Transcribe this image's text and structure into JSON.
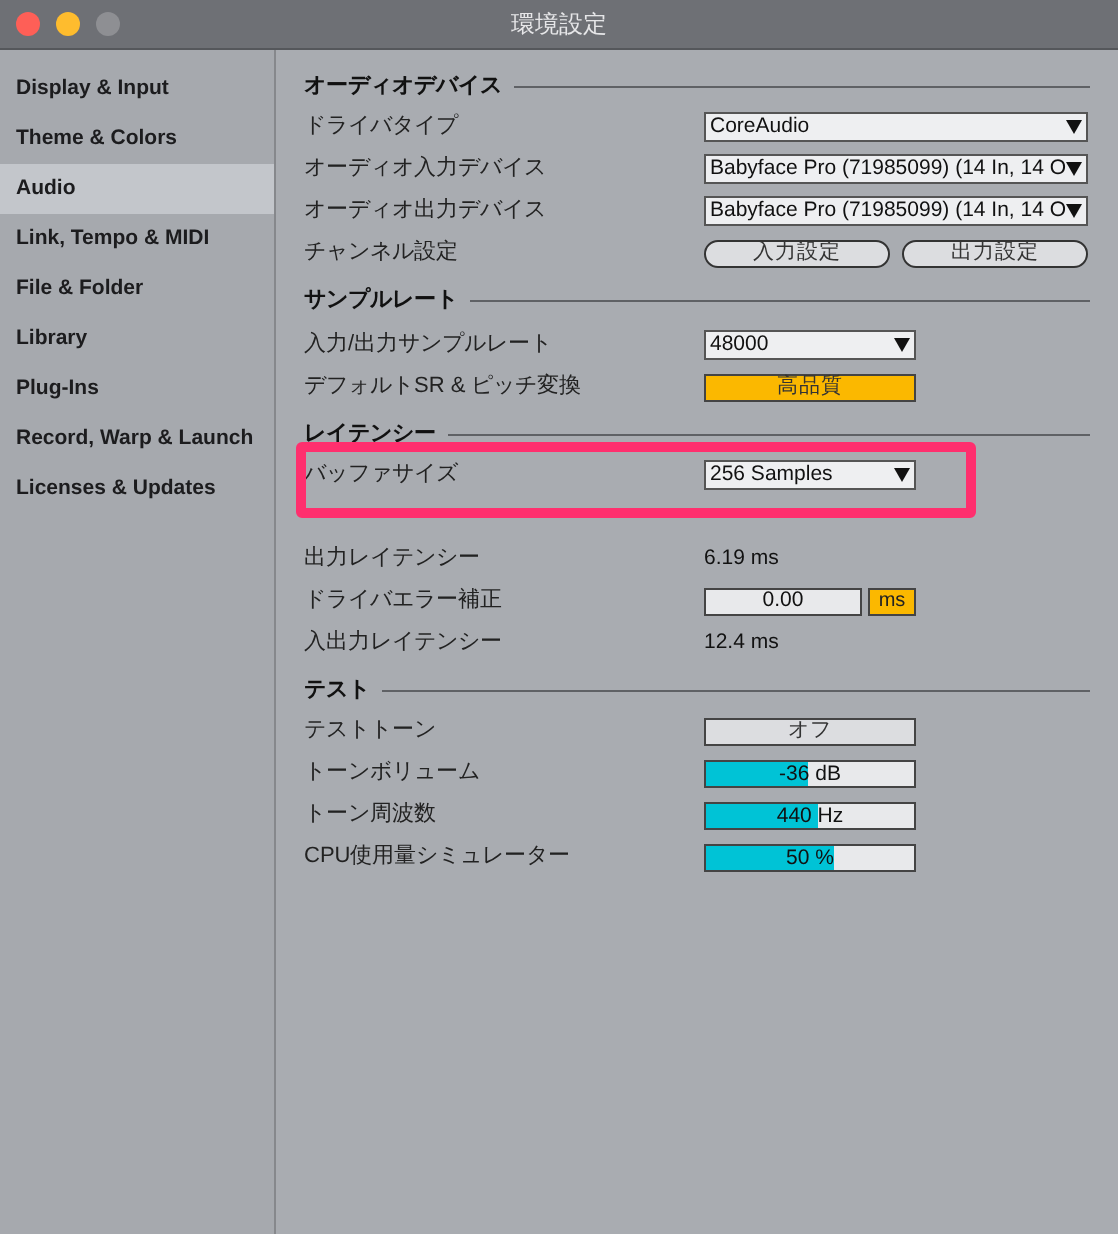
{
  "window": {
    "title": "環境設定",
    "controls": [
      {
        "color": "#fe5f57"
      },
      {
        "color": "#febc2e"
      },
      {
        "color": "#8e8f93"
      }
    ]
  },
  "sidebar": {
    "items": [
      {
        "label": "Display & Input",
        "selected": false
      },
      {
        "label": "Theme & Colors",
        "selected": false
      },
      {
        "label": "Audio",
        "selected": true
      },
      {
        "label": "Link, Tempo & MIDI",
        "selected": false
      },
      {
        "label": "File & Folder",
        "selected": false
      },
      {
        "label": "Library",
        "selected": false
      },
      {
        "label": "Plug-Ins",
        "selected": false
      },
      {
        "label": "Record, Warp & Launch",
        "selected": false
      },
      {
        "label": "Licenses & Updates",
        "selected": false
      }
    ]
  },
  "sections": [
    {
      "title": "オーディオデバイス",
      "rows": [
        {
          "kind": "dropdown",
          "label": "ドライバタイプ",
          "value": "CoreAudio",
          "wide": true
        },
        {
          "kind": "dropdown",
          "label": "オーディオ入力デバイス",
          "value": "Babyface Pro (71985099) (14 In, 14 O",
          "wide": true
        },
        {
          "kind": "dropdown",
          "label": "オーディオ出力デバイス",
          "value": "Babyface Pro (71985099) (14 In, 14 O",
          "wide": true
        },
        {
          "kind": "buttons",
          "label": "チャンネル設定",
          "buttons": [
            "入力設定",
            "出力設定"
          ]
        }
      ]
    },
    {
      "title": "サンプルレート",
      "rows": [
        {
          "kind": "dropdown",
          "label": "入力/出力サンプルレート",
          "value": "48000",
          "wide": false
        },
        {
          "kind": "toggle",
          "label": "デフォルトSR & ピッチ変換",
          "value": "高品質",
          "on": true
        }
      ]
    },
    {
      "title": "レイテンシー",
      "rows": [
        {
          "kind": "dropdown",
          "label": "バッファサイズ",
          "value": "256 Samples",
          "wide": false,
          "highlighted": true
        },
        {
          "kind": "obscured"
        },
        {
          "kind": "reading",
          "label": "出力レイテンシー",
          "value": "6.19 ms"
        },
        {
          "kind": "number",
          "label": "ドライバエラー補正",
          "value": "0.00",
          "unit": "ms",
          "unit_on": true
        },
        {
          "kind": "reading",
          "label": "入出力レイテンシー",
          "value": "12.4 ms"
        }
      ]
    },
    {
      "title": "テスト",
      "rows": [
        {
          "kind": "toggle",
          "label": "テストトーン",
          "value": "オフ",
          "on": false
        },
        {
          "kind": "slider",
          "label": "トーンボリューム",
          "value": "-36 dB",
          "level": 0.49
        },
        {
          "kind": "slider",
          "label": "トーン周波数",
          "value": "440 Hz",
          "level": 0.54
        },
        {
          "kind": "slider",
          "label": "CPU使用量シミュレーター",
          "value": "50 %",
          "level": 0.62
        }
      ]
    }
  ]
}
